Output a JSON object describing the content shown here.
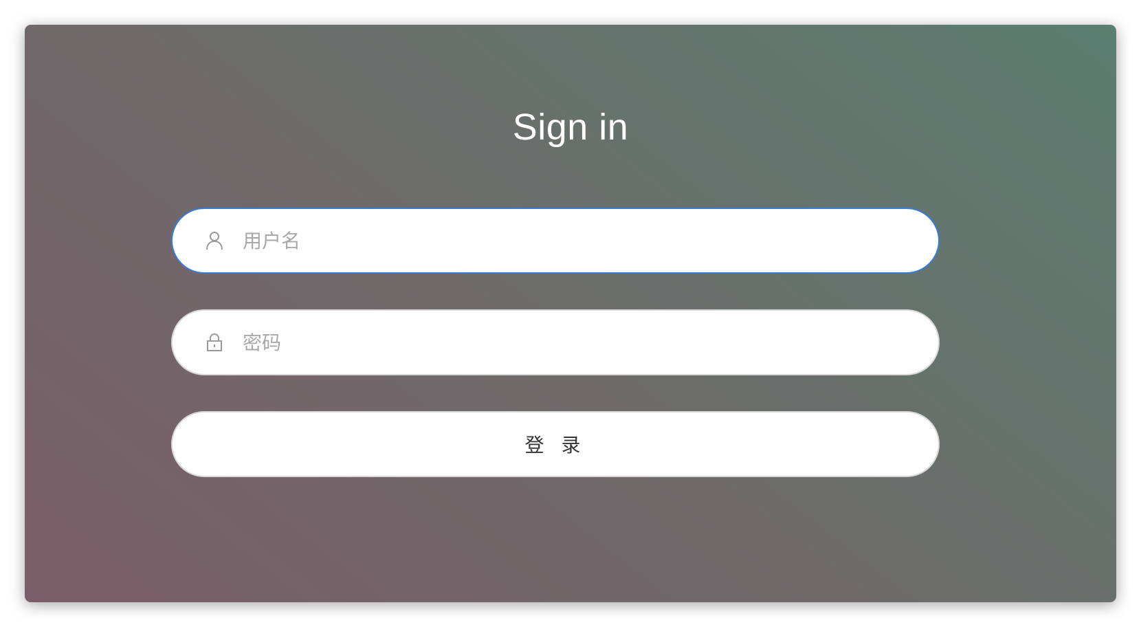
{
  "login": {
    "title": "Sign in",
    "username": {
      "placeholder": "用户名",
      "value": "",
      "icon": "user-icon"
    },
    "password": {
      "placeholder": "密码",
      "value": "",
      "icon": "lock-icon"
    },
    "submit_label": "登 录"
  },
  "colors": {
    "gradient_start": "#7a5d68",
    "gradient_mid": "#6e6a6a",
    "gradient_end": "#5b7e71",
    "focus_border": "#3a7bd5",
    "placeholder": "#a8a8a8"
  }
}
